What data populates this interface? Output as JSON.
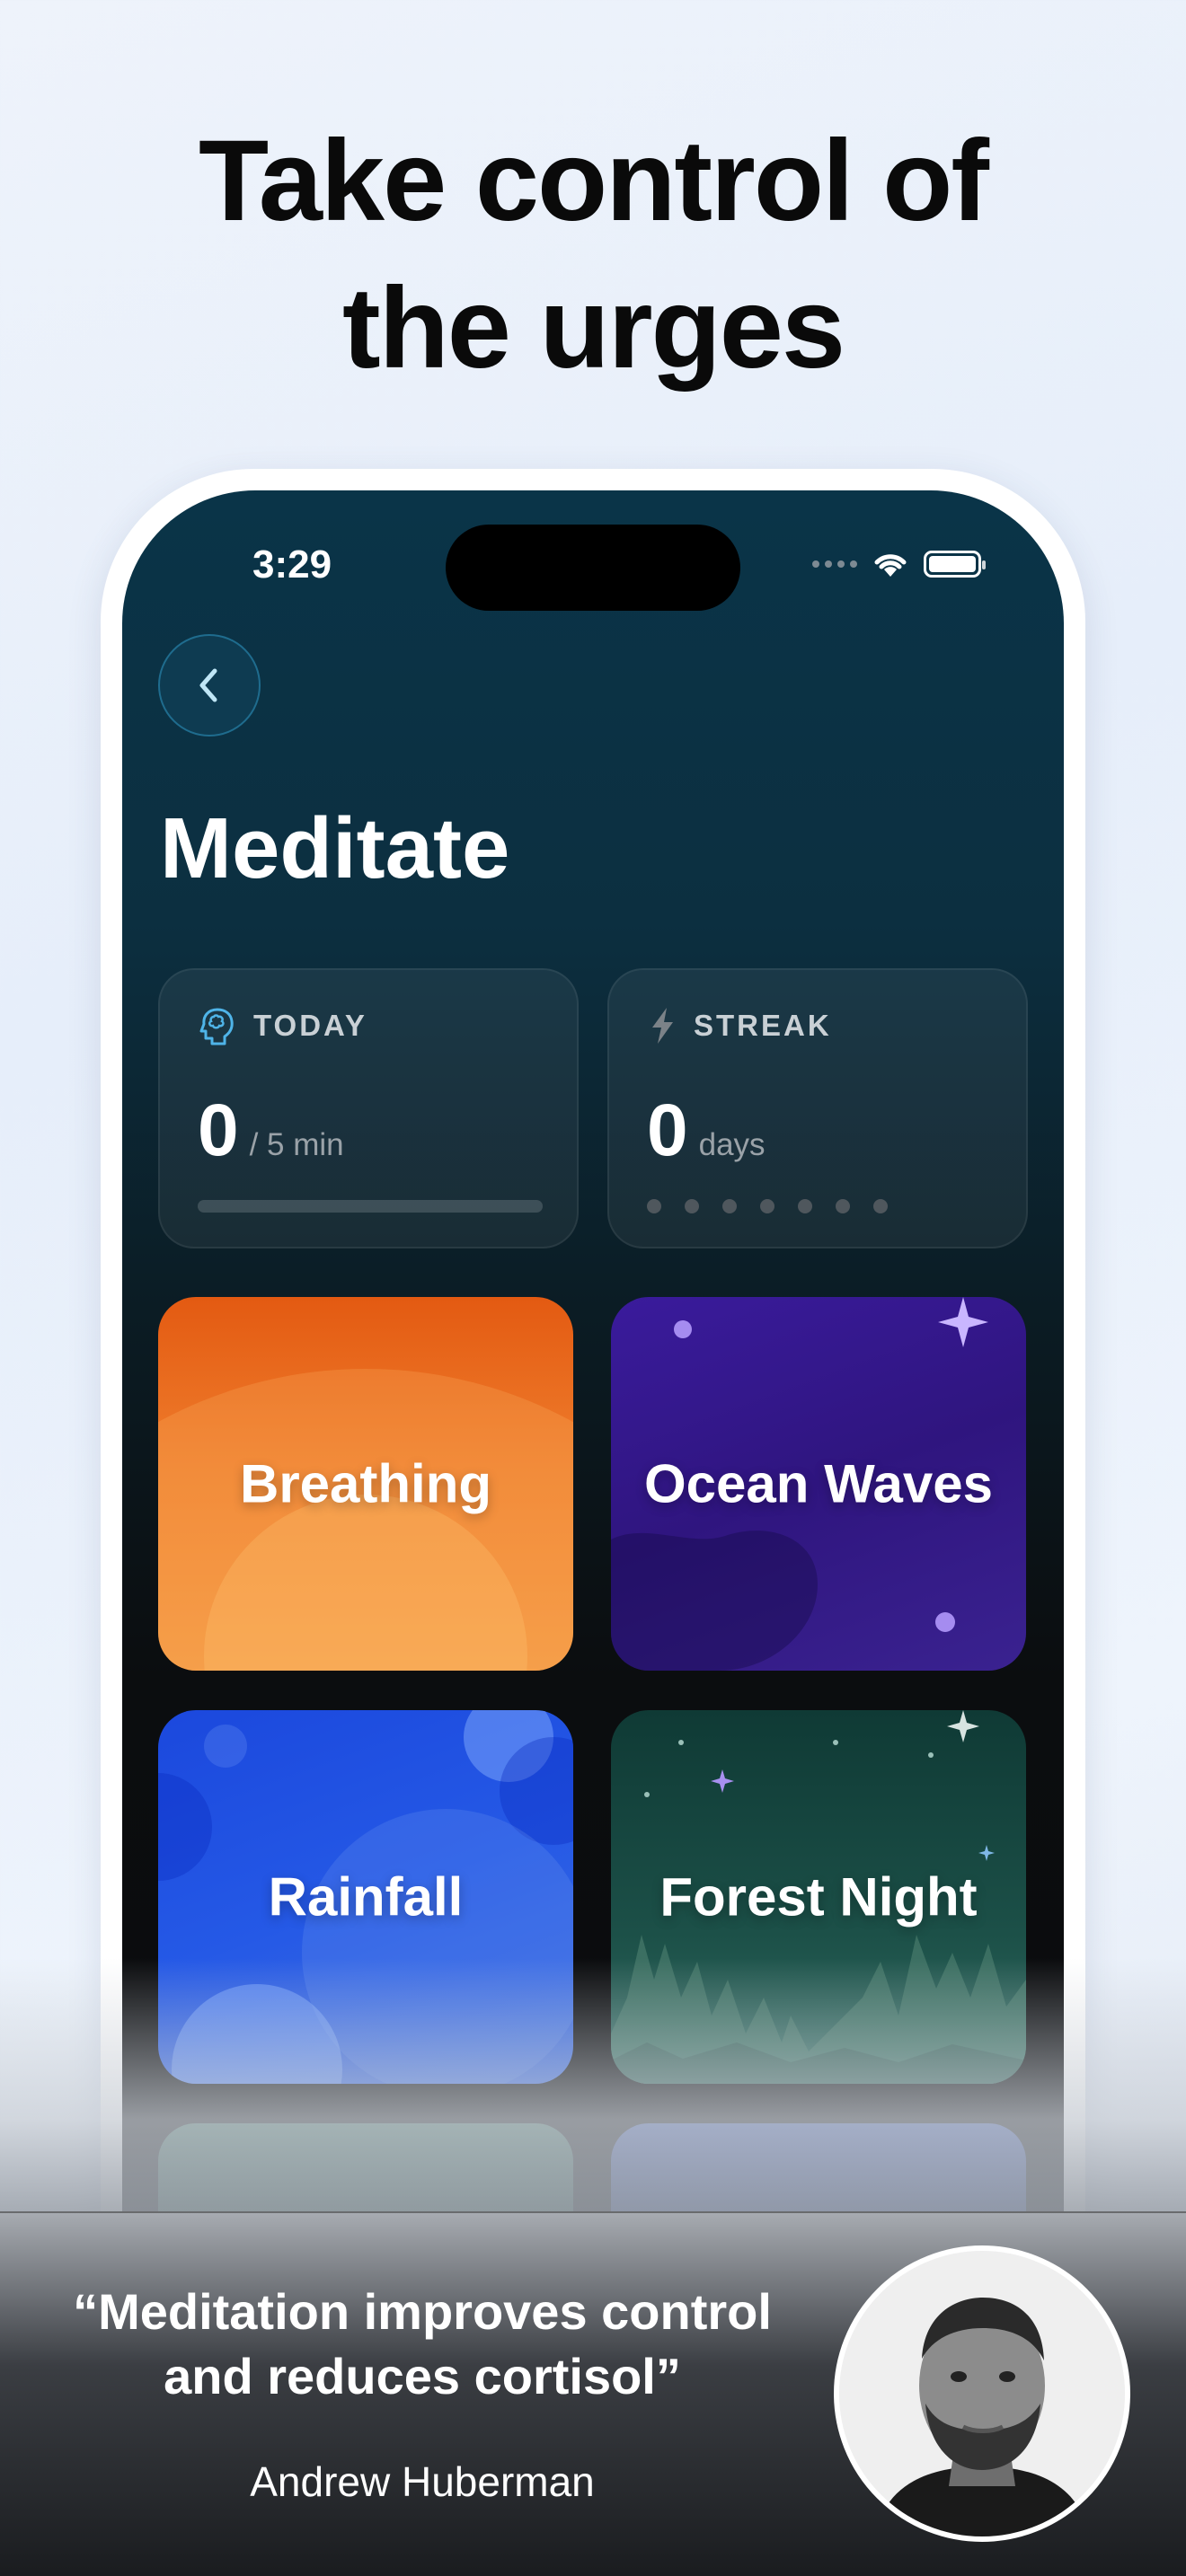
{
  "headline": {
    "line1": "Take control of",
    "line2": "the urges"
  },
  "status_bar": {
    "time": "3:29"
  },
  "screen": {
    "title": "Meditate",
    "today": {
      "label": "TODAY",
      "value": "0",
      "unit": "/ 5 min",
      "progress": 0
    },
    "streak": {
      "label": "STREAK",
      "value": "0",
      "unit": "days",
      "dots_total": 7,
      "dots_filled": 0
    },
    "tiles": [
      {
        "label": "Breathing"
      },
      {
        "label": "Ocean Waves"
      },
      {
        "label": "Rainfall"
      },
      {
        "label": "Forest Night"
      }
    ],
    "colors": {
      "accent": "#4fb4e8",
      "breathing": "#ef7d2c",
      "ocean": "#3a1b9c",
      "rain": "#2559e6",
      "forest": "#1c5048"
    }
  },
  "quote": {
    "line1": "“Meditation improves control",
    "line2": "and reduces cortisol”",
    "author": "Andrew Huberman"
  },
  "icons": [
    "chevron-left-icon",
    "brain-icon",
    "bolt-icon",
    "wifi-icon",
    "battery-icon"
  ]
}
